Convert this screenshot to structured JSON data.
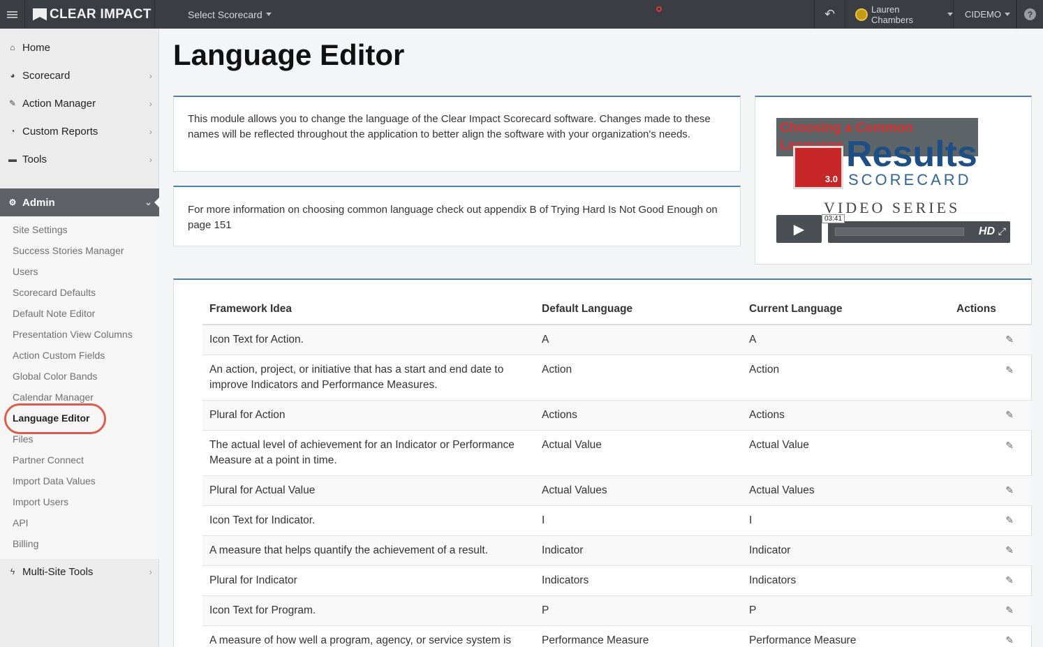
{
  "topbar": {
    "logo": "CLEAR IMPACT",
    "select_scorecard": "Select Scorecard",
    "undo_icon": "↶",
    "user": "Lauren Chambers",
    "org": "CIDEMO",
    "help": "?"
  },
  "sidebar": {
    "nav": [
      {
        "label": "Home",
        "icon": "home-icon",
        "glyph": "⌂"
      },
      {
        "label": "Scorecard",
        "icon": "dashboard-icon",
        "glyph": "◕"
      },
      {
        "label": "Action Manager",
        "icon": "wrench-icon",
        "glyph": "🔧"
      },
      {
        "label": "Custom Reports",
        "icon": "pie-chart-icon",
        "glyph": "◔"
      },
      {
        "label": "Tools",
        "icon": "briefcase-icon",
        "glyph": "▬"
      }
    ],
    "admin": {
      "label": "Admin",
      "icon": "cogs-icon",
      "glyph": "⚙"
    },
    "sub_items": [
      "Site Settings",
      "Success Stories Manager",
      "Users",
      "Scorecard Defaults",
      "Default Note Editor",
      "Presentation View Columns",
      "Action Custom Fields",
      "Global Color Bands",
      "Calendar Manager",
      "Language Editor",
      "Files",
      "Partner Connect",
      "Import Data Values",
      "Import Users",
      "API",
      "Billing"
    ],
    "multisite": {
      "label": "Multi-Site Tools",
      "icon": "bolt-icon",
      "glyph": "ϟ"
    }
  },
  "main": {
    "title": "Language Editor",
    "info1": "This module allows you to change the language of the Clear Impact Scorecard software. Changes made to these names will be reflected throughout the application to better align the software with your organization's needs.",
    "info2": "For more information on choosing common language check out appendix B of Trying Hard Is Not Good Enough on page 151",
    "video": {
      "title": "Choosing a Common Language",
      "version": "3.0",
      "brand": "Results",
      "brand_sub": "SCORECARD",
      "series": "VIDEO SERIES",
      "time": "03:41",
      "hd": "HD"
    },
    "table": {
      "headers": [
        "Framework Idea",
        "Default Language",
        "Current Language",
        "Actions"
      ],
      "rows": [
        {
          "idea": "Icon Text for Action.",
          "default": "A",
          "current": "A"
        },
        {
          "idea": "An action, project, or initiative that has a start and end date to improve Indicators and Performance Measures.",
          "default": "Action",
          "current": "Action"
        },
        {
          "idea": "Plural for Action",
          "default": "Actions",
          "current": "Actions"
        },
        {
          "idea": "The actual level of achievement for an Indicator or Performance Measure at a point in time.",
          "default": "Actual Value",
          "current": "Actual Value"
        },
        {
          "idea": "Plural for Actual Value",
          "default": "Actual Values",
          "current": "Actual Values"
        },
        {
          "idea": "Icon Text for Indicator.",
          "default": "I",
          "current": "I"
        },
        {
          "idea": "A measure that helps quantify the achievement of a result.",
          "default": "Indicator",
          "current": "Indicator"
        },
        {
          "idea": "Plural for Indicator",
          "default": "Indicators",
          "current": "Indicators"
        },
        {
          "idea": "Icon Text for Program.",
          "default": "P",
          "current": "P"
        },
        {
          "idea": "A measure of how well a program, agency, or service system is",
          "default": "Performance Measure",
          "current": "Performance Measure"
        }
      ]
    }
  }
}
